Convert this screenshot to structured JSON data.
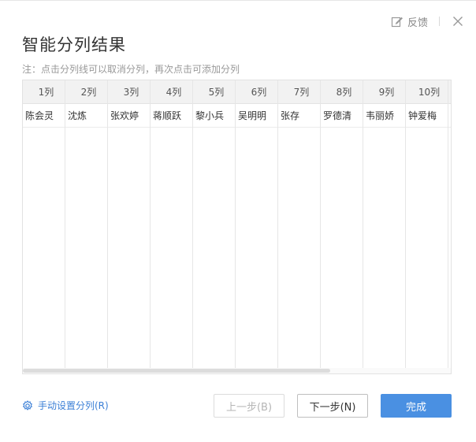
{
  "header": {
    "feedback_label": "反馈",
    "title": "智能分列结果",
    "note": "注：点击分列线可以取消分列，再次点击可添加分列"
  },
  "table": {
    "columns": [
      "1列",
      "2列",
      "3列",
      "4列",
      "5列",
      "6列",
      "7列",
      "8列",
      "9列",
      "10列"
    ],
    "row": [
      "陈会灵",
      "沈炼",
      "张欢婷",
      "蒋顺跃",
      "黎小兵",
      "吴明明",
      "张存",
      "罗德清",
      "韦丽娇",
      "钟爱梅"
    ]
  },
  "footer": {
    "manual_split_label": "手动设置分列(R)",
    "prev_label": "上一步(B)",
    "next_label": "下一步(N)",
    "done_label": "完成"
  },
  "icons": {
    "feedback": "edit-icon",
    "close": "close-icon",
    "manual": "gear-icon"
  },
  "colors": {
    "accent": "#4a90e2",
    "link": "#3b7fd6"
  }
}
